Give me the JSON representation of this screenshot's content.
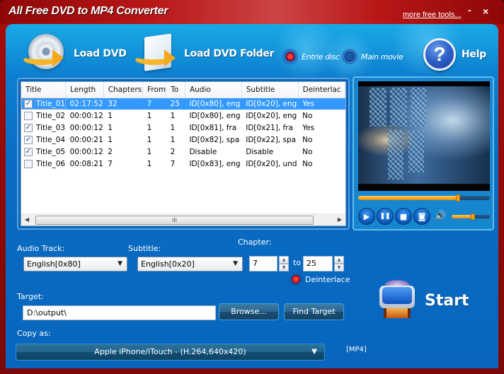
{
  "window": {
    "title": "All Free DVD to MP4 Converter",
    "more_tools_link": "more free tools...",
    "minimize_glyph": "-",
    "close_glyph": "×"
  },
  "toolbar": {
    "load_dvd": "Load DVD",
    "load_dvd_folder": "Load DVD Folder",
    "mode_options": [
      {
        "label": "Entrie disc",
        "selected": true
      },
      {
        "label": "Main movie",
        "selected": false
      }
    ],
    "help": "Help",
    "help_glyph": "?"
  },
  "titles_table": {
    "columns": [
      "Title",
      "Length",
      "Chapters",
      "From",
      "To",
      "Audio",
      "Subtitle",
      "Deinterlac"
    ],
    "rows": [
      {
        "checked": true,
        "title": "Title_01",
        "length": "02:17:52",
        "chapters": "32",
        "from": "7",
        "to": "25",
        "audio": "ID[0x80], eng",
        "subtitle": "ID[0x20], eng",
        "deinterlace": "Yes",
        "selected": true
      },
      {
        "checked": false,
        "title": "Title_02",
        "length": "00:00:12",
        "chapters": "1",
        "from": "1",
        "to": "1",
        "audio": "ID[0x80], eng",
        "subtitle": "ID[0x20], eng",
        "deinterlace": "No",
        "selected": false
      },
      {
        "checked": true,
        "title": "Title_03",
        "length": "00:00:12",
        "chapters": "1",
        "from": "1",
        "to": "1",
        "audio": "ID[0x81], fra",
        "subtitle": "ID[0x21], fra",
        "deinterlace": "Yes",
        "selected": false
      },
      {
        "checked": true,
        "title": "Title_04",
        "length": "00:00:21",
        "chapters": "1",
        "from": "1",
        "to": "1",
        "audio": "ID[0x82], spa",
        "subtitle": "ID[0x22], spa",
        "deinterlace": "No",
        "selected": false
      },
      {
        "checked": true,
        "title": "Title_05",
        "length": "00:00:12",
        "chapters": "2",
        "from": "1",
        "to": "2",
        "audio": "Disable",
        "subtitle": "Disable",
        "deinterlace": "No",
        "selected": false
      },
      {
        "checked": false,
        "title": "Title_06",
        "length": "00:08:21",
        "chapters": "7",
        "from": "1",
        "to": "7",
        "audio": "ID[0x83], eng",
        "subtitle": "ID[0x20], und",
        "deinterlace": "No",
        "selected": false
      }
    ],
    "scroll_thumb_grip": "III"
  },
  "player": {
    "seek_progress": 0.76,
    "volume_level": 0.55,
    "controls": [
      {
        "name": "play",
        "glyph": "▶"
      },
      {
        "name": "pause",
        "glyph": "❚❚"
      },
      {
        "name": "stop",
        "glyph": "■"
      },
      {
        "name": "snapshot",
        "glyph": "◙"
      }
    ],
    "volume_glyph": "🔊"
  },
  "options": {
    "audio_track_label": "Audio Track:",
    "audio_track_value": "English[0x80]",
    "subtitle_label": "Subtitle:",
    "subtitle_value": "English[0x20]",
    "chapter_label": "Chapter:",
    "chapter_from": "7",
    "chapter_to_label": "to",
    "chapter_to": "25",
    "deinterlace_label": "Deinterlace",
    "deinterlace_on": true
  },
  "target": {
    "label": "Target:",
    "path": "D:\\output\\",
    "browse": "Browse...",
    "find_target": "Find Target"
  },
  "start": {
    "label": "Start"
  },
  "copy_as": {
    "label": "Copy as:",
    "profile": "Apple iPhone/iTouch - (H.264,640x420)",
    "format_tag": "[MP4]"
  },
  "colors": {
    "frame_red": "#b81414",
    "panel_blue": "#0a6cc4",
    "selection_blue": "#3399ff",
    "seek_orange": "#f3a21a"
  }
}
